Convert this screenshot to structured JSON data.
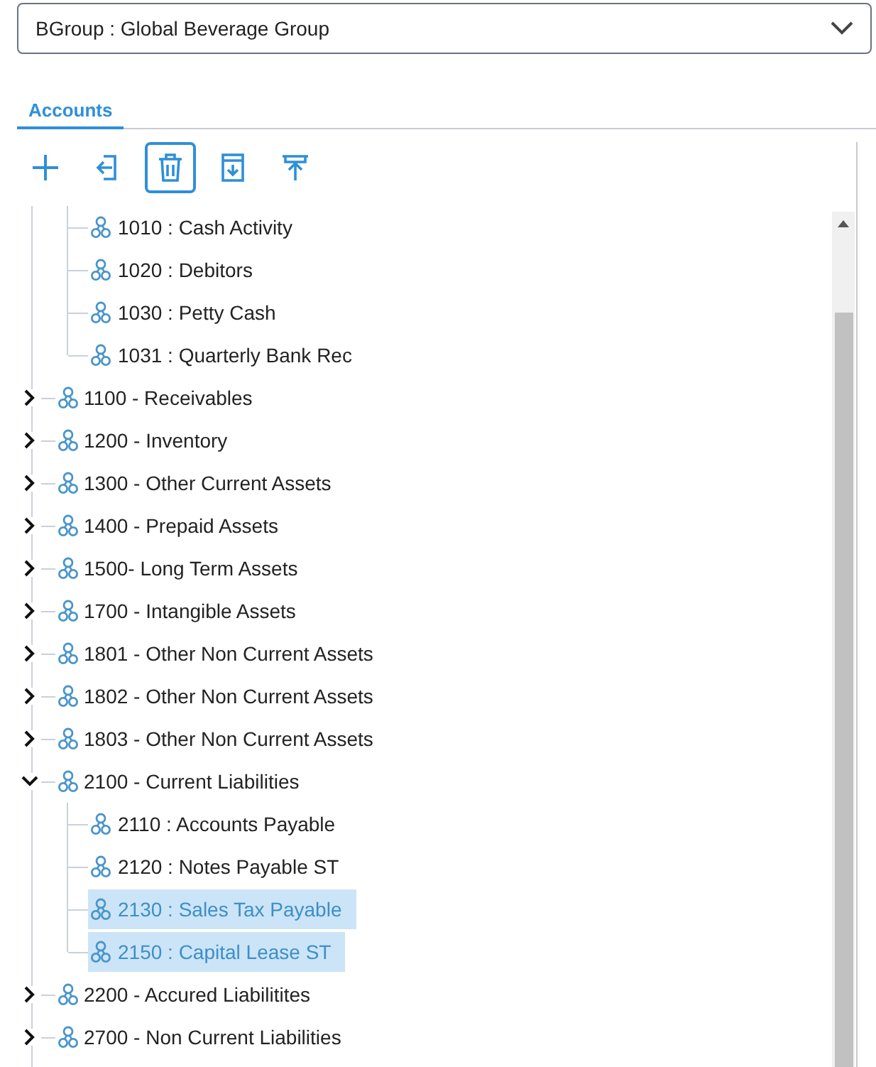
{
  "group_select": {
    "value": "BGroup : Global Beverage Group"
  },
  "tabs": [
    {
      "label": "Accounts",
      "selected": true
    }
  ],
  "toolbar": [
    {
      "kind": "add",
      "selected": false
    },
    {
      "kind": "import",
      "selected": false
    },
    {
      "kind": "delete",
      "selected": true
    },
    {
      "kind": "download",
      "selected": false
    },
    {
      "kind": "upload",
      "selected": false
    }
  ],
  "tree": {
    "continued_children": [
      {
        "label": "1010 : Cash Activity",
        "selected": false
      },
      {
        "label": "1020 : Debitors",
        "selected": false
      },
      {
        "label": "1030 : Petty Cash",
        "selected": false
      },
      {
        "label": "1031 : Quarterly Bank Rec",
        "selected": false
      }
    ],
    "items": [
      {
        "label": "1100 - Receivables",
        "expanded": false
      },
      {
        "label": "1200 - Inventory",
        "expanded": false
      },
      {
        "label": "1300 - Other Current Assets",
        "expanded": false
      },
      {
        "label": "1400 - Prepaid Assets",
        "expanded": false
      },
      {
        "label": "1500- Long Term Assets",
        "expanded": false
      },
      {
        "label": "1700 - Intangible Assets",
        "expanded": false
      },
      {
        "label": "1801 - Other Non Current Assets",
        "expanded": false
      },
      {
        "label": "1802 - Other Non Current Assets",
        "expanded": false
      },
      {
        "label": "1803 - Other Non Current Assets",
        "expanded": false
      },
      {
        "label": "2100 - Current Liabilities",
        "expanded": true,
        "children": [
          {
            "label": "2110 : Accounts Payable",
            "selected": false
          },
          {
            "label": "2120 : Notes Payable ST",
            "selected": false
          },
          {
            "label": "2130 : Sales Tax Payable",
            "selected": true
          },
          {
            "label": "2150 : Capital Lease ST",
            "selected": true
          }
        ]
      },
      {
        "label": "2200 - Accured Liabilitites",
        "expanded": false
      },
      {
        "label": "2700 - Non Current Liabilities",
        "expanded": false
      }
    ]
  }
}
